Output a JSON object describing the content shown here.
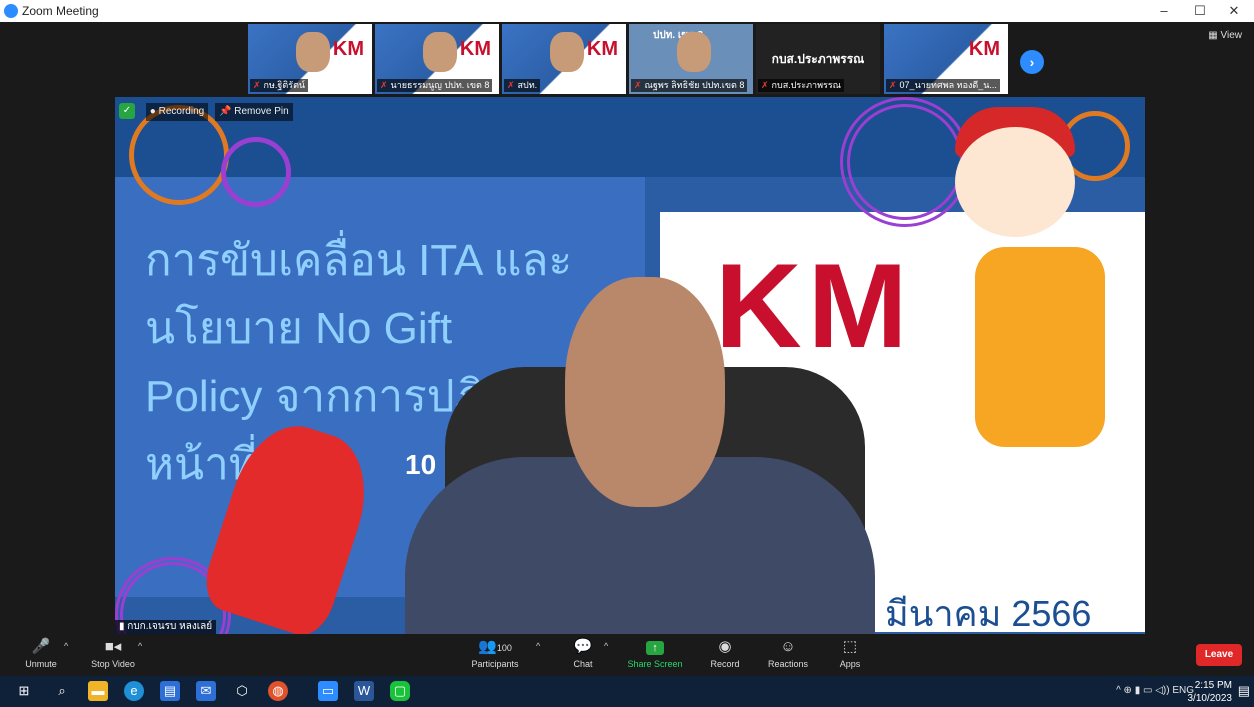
{
  "window": {
    "title": "Zoom Meeting",
    "minimize": "–",
    "maximize": "☐",
    "close": "✕"
  },
  "gallery": {
    "view_label": "View",
    "thumbnails": [
      {
        "name": "กษ.ฐิติรัตน์",
        "type": "video"
      },
      {
        "name": "นายธรรมนูญ ปปท. เขต 8",
        "type": "video"
      },
      {
        "name": "สปท.",
        "type": "video"
      },
      {
        "name": "ณฐพร ลิทธิชัย ปปท.เขต 8",
        "type": "video",
        "overlay": "ปปท. เขต 8"
      },
      {
        "name": "กบส.ประภาพรรณ",
        "type": "text",
        "display": "กบส.ประภาพรรณ"
      },
      {
        "name": "07_นายทศพล ทองดี_น...",
        "type": "video"
      }
    ]
  },
  "main_video": {
    "slide_lines": [
      "การขับเคลื่อน ITA และ",
      "นโยบาย No Gift",
      "Policy จากการปฏิบัติ",
      "หน้าที่"
    ],
    "slide_number": "10",
    "km_text": "KM",
    "date_text": "มีนาคม 2566",
    "recording_label": "Recording",
    "remove_pin_label": "Remove Pin",
    "participant_name": "กบก.เจนรบ หลงเลย์"
  },
  "toolbar": {
    "unmute": "Unmute",
    "stop_video": "Stop Video",
    "participants": "Participants",
    "participants_count": "100",
    "chat": "Chat",
    "share_screen": "Share Screen",
    "record": "Record",
    "reactions": "Reactions",
    "apps": "Apps",
    "leave": "Leave"
  },
  "taskbar": {
    "tray_text": "ENG",
    "time": "2:15 PM",
    "date": "3/10/2023"
  },
  "colors": {
    "zoom_blue": "#2d8cff",
    "leave_red": "#e02828",
    "share_green": "#26a541"
  }
}
